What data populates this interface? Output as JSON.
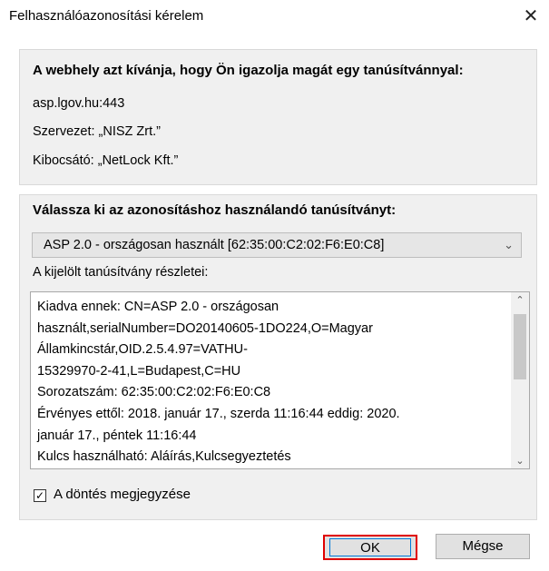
{
  "dialog": {
    "title": "Felhasználóazonosítási kérelem",
    "close_glyph": "✕"
  },
  "site_info": {
    "heading": "A webhely azt kívánja, hogy Ön igazolja magát egy tanúsítvánnyal:",
    "host": "asp.lgov.hu:443",
    "organization": "Szervezet: „NISZ Zrt.”",
    "issuer": "Kibocsátó: „NetLock Kft.”"
  },
  "cert_select": {
    "heading": "Válassza ki az azonosításhoz használandó tanúsítványt:",
    "selected": "ASP 2.0 - országosan használt [62:35:00:C2:02:F6:E0:C8]",
    "details_label": "A kijelölt tanúsítvány részletei:",
    "details_lines": [
      "Kiadva ennek: CN=ASP 2.0 - országosan",
      "használt,serialNumber=DO20140605-1DO224,O=Magyar",
      "Államkincstár,OID.2.5.4.97=VATHU-",
      "15329970-2-41,L=Budapest,C=HU",
      "Sorozatszám: 62:35:00:C2:02:F6:E0:C8",
      "Érvényes ettől: 2018. január 17., szerda 11:16:44 eddig: 2020.",
      "január 17., péntek 11:16:44",
      "Kulcs használható: Aláírás,Kulcsegyeztetés"
    ],
    "remember_label": "A döntés megjegyzése",
    "remember_checked": true
  },
  "buttons": {
    "ok": "OK",
    "cancel": "Mégse"
  },
  "colors": {
    "highlight_border": "#e00000",
    "panel_bg": "#f0f0f0"
  }
}
